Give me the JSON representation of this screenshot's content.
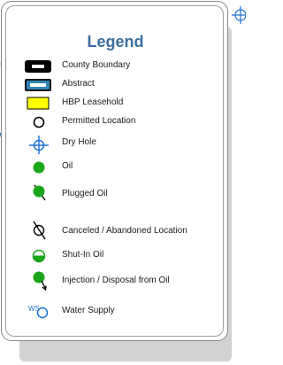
{
  "legend": {
    "title": "Legend",
    "items": [
      {
        "label": "County Boundary",
        "icon": "county-boundary-icon"
      },
      {
        "label": "Abstract",
        "icon": "abstract-icon"
      },
      {
        "label": "HBP Leasehold",
        "icon": "hbp-leasehold-icon"
      },
      {
        "label": "Permitted Location",
        "icon": "permitted-location-icon"
      },
      {
        "label": "Dry Hole",
        "icon": "dry-hole-icon"
      },
      {
        "label": "Oil",
        "icon": "oil-icon"
      },
      {
        "label": "Plugged Oil",
        "icon": "plugged-oil-icon"
      },
      {
        "label": "Canceled / Abandoned Location",
        "icon": "canceled-location-icon"
      },
      {
        "label": "Shut-In Oil",
        "icon": "shut-in-oil-icon"
      },
      {
        "label": "Injection / Disposal from Oil",
        "icon": "injection-disposal-icon"
      },
      {
        "label": "Water Supply",
        "icon": "water-supply-icon",
        "prefix": "WS"
      }
    ]
  },
  "colors": {
    "title": "#3b6e9e",
    "abstract": "#2e86b5",
    "hbp": "#ffff00",
    "oil_green": "#1aa51a",
    "water_blue": "#1a6fd6"
  }
}
